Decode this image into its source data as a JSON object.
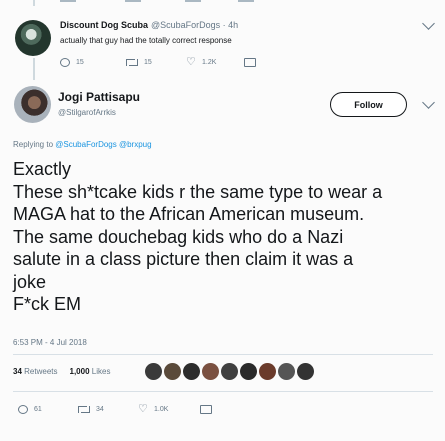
{
  "reply": {
    "name": "Discount Dog Scuba",
    "handle": "@ScubaForDogs · 4h",
    "text": "actually that guy had the totally correct response",
    "replies": "15",
    "retweets": "15",
    "likes": "1.2K"
  },
  "tweet": {
    "name": "Jogi Pattisapu",
    "handle": "@StilgarofArrkis",
    "follow_label": "Follow",
    "replying_prefix": "Replying to",
    "replying_to": "@ScubaForDogs @brxpug",
    "lines": [
      "Exactly",
      "These sh*tcake kids r the same type to wear a",
      "MAGA hat to the African American museum.",
      "The same douchebag kids who do a Nazi",
      "salute in a class picture then claim it was a",
      "joke",
      "F*ck EM"
    ],
    "timestamp": "6:53 PM - 4 Jul 2018",
    "retweets_count": "34",
    "retweets_label": "Retweets",
    "likes_count": "1,000",
    "likes_label": "Likes",
    "replies": "61",
    "retweets": "34",
    "likes": "1.0K"
  },
  "liker_colors": [
    "#3a3a3a",
    "#5a4a3a",
    "#2c2c2c",
    "#7a5040",
    "#404040",
    "#2a2a2a",
    "#6b3b2b",
    "#555",
    "#333"
  ]
}
